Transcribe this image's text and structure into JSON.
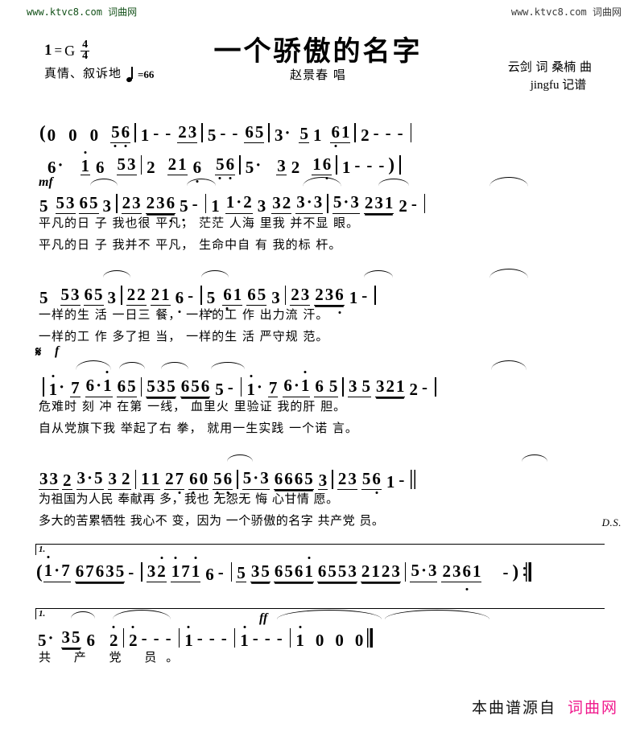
{
  "watermarks": {
    "left": "www.ktvc8.com 词曲网",
    "right": "www.ktvc8.com 词曲网",
    "left_color": "#14521a",
    "right_color": "#3a3a3a"
  },
  "header": {
    "title": "一个骄傲的名字",
    "singer": "赵景春 唱",
    "key_label": "1",
    "key_equals": "=",
    "key_value": "G",
    "time_num": "4",
    "time_den": "4",
    "mood": "真情、叙诉地",
    "tempo": "=66",
    "credit_line1": "云剑 词 桑楠 曲",
    "credit_line2": "jingfu 记谱"
  },
  "markings": {
    "mf": "mf",
    "f": "f",
    "ff": "ff",
    "segno": "𝄋",
    "ds": "D.S.",
    "volta1": "1.",
    "volta2": "1."
  },
  "chart_data": {
    "type": "table",
    "title": "一个骄傲的名字 — 简谱 (jianpu numbered notation)",
    "key": "1=G",
    "meter": "4/4",
    "tempo_bpm": 66,
    "systems": [
      {
        "id": "intro-line-1",
        "role": "prelude",
        "notes": "( 0 0 0 5̣6̣ | 1 - - 23 | 5 - - 65 | 3· 5 1 6̣1 | 2 - - - |"
      },
      {
        "id": "intro-line-2",
        "role": "prelude",
        "notes": "6· i̇ 6 53 | 2 21 6̣ 5̣6̣ | 5· 32 16̣ | 1 - - - ) |"
      },
      {
        "id": "verse-line-1",
        "role": "verse",
        "dynamic": "mf",
        "notes": "5 53 65 3 | 23 236̣ 5̣ - | 1 1·2 3 32 3·3 | 5·3 231 2 - |",
        "lyric1": "平凡的日 子 我也很 平凡， 茫茫 人海 里我 并不显 眼。",
        "lyric2": "平凡的日 子 我并不 平凡， 生命中自 有 我的标 杆。"
      },
      {
        "id": "verse-line-2",
        "role": "verse",
        "notes": "5 53 65 3 | 22 21 6̣ - | 5̣ 6̣1 65 3 | 23 236̣ 1 - |",
        "lyric1": "一样的生 活 一日三 餐， 一样的工 作 出力流 汗。",
        "lyric2": "一样的工 作 多了担 当， 一样的生 活 严守规 范。"
      },
      {
        "id": "chorus-line-1",
        "role": "chorus",
        "dynamic": "f",
        "segno": true,
        "notes": "| i̇· 7 6·i̇ 65 | 535 656 5 - | i̇· 7 6·i̇ 6 5 | 35 321 2 - |",
        "lyric1": "危难时 刻 冲 在第 一线， 血里火 里验证 我的肝 胆。",
        "lyric2": "自从党旗下我 举起了右 拳， 就用一生实践 一个诺 言。"
      },
      {
        "id": "chorus-line-2",
        "role": "chorus",
        "notes": "33 2 3·5 32 | 11 27̣ 6̣0 5̣6̣ | 5·3 6665 3 | 23 56̣ 1 - ‖",
        "lyric1": "为祖国为人民 奉献再 多，我也 无怨无 悔 心甘情 愿。",
        "lyric2": "多大的苦累牺牲 我心不 变，因为 一个骄傲的名字 共产党 员。",
        "ds": "D.S."
      },
      {
        "id": "ending-1",
        "role": "first-ending",
        "volta": "1.",
        "notes": "( i̇· 7 67635 - | 3i̇ i̇7i̇ 6 - | 5 35 656i̇ 6553 2123 | 5·3 2361 - ) :‖"
      },
      {
        "id": "ending-2",
        "role": "second-ending",
        "volta": "1.",
        "dynamic": "ff",
        "notes": "5· 35 6 2̇ | 2̇ - - - | i̇ - - - | i̇ - - - | i̇ 0 0 0 ‖",
        "lyric1": "共 产 党 员。"
      }
    ]
  },
  "footer": {
    "source_text": "本曲谱源自",
    "site_text": "词曲网",
    "site_color": "#f01a8d"
  }
}
